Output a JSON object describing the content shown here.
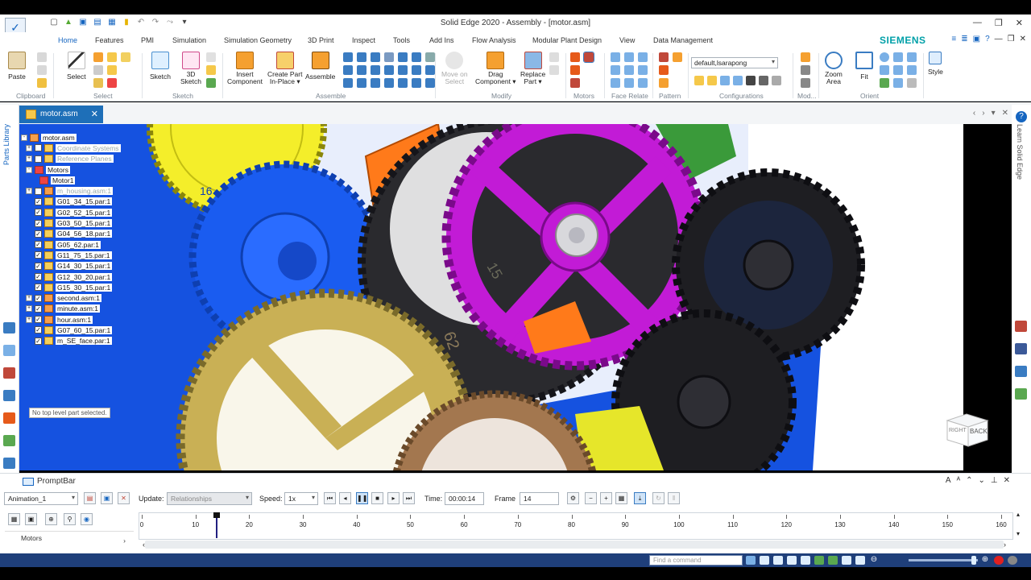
{
  "window": {
    "title": "Solid Edge 2020 - Assembly - [motor.asm]",
    "brand": "SIEMENS"
  },
  "tabs": [
    "Home",
    "Features",
    "PMI",
    "Simulation",
    "Simulation Geometry",
    "3D Print",
    "Inspect",
    "Tools",
    "Add Ins",
    "Flow Analysis",
    "Modular Plant Design",
    "View",
    "Data Management"
  ],
  "ribbon": {
    "buttons": {
      "paste": "Paste",
      "select": "Select",
      "sketch": "Sketch",
      "sketch3d": "3D\nSketch",
      "insert_component": "Insert\nComponent",
      "create_part": "Create Part\nIn-Place ▾",
      "assemble": "Assemble",
      "move_on_select": "Move on\nSelect",
      "drag_component": "Drag\nComponent ▾",
      "replace_part": "Replace\nPart ▾",
      "zoom_area": "Zoom\nArea",
      "fit": "Fit",
      "style": "Style"
    },
    "groups": {
      "clipboard": "Clipboard",
      "select": "Select",
      "sketch": "Sketch",
      "assemble": "Assemble",
      "modify": "Modify",
      "motors": "Motors",
      "face_relate": "Face Relate",
      "pattern": "Pattern",
      "configurations": "Configurations",
      "modify2": "Mod...",
      "orient": "Orient"
    },
    "configuration_value": "default,lsarapong"
  },
  "document": {
    "tab_label": "motor.asm"
  },
  "side": {
    "left_panel": "Parts Library",
    "right_panel": "Learn Solid Edge"
  },
  "tree": {
    "items": [
      {
        "label": "motor.asm",
        "level": 0,
        "exp": "-",
        "cb": false,
        "icon": "asm"
      },
      {
        "label": "Coordinate Systems",
        "level": 1,
        "exp": "+",
        "cb": "",
        "icon": "coord",
        "dim": true
      },
      {
        "label": "Reference Planes",
        "level": 1,
        "exp": "+",
        "cb": "",
        "icon": "planes",
        "dim": true
      },
      {
        "label": "Motors",
        "level": 1,
        "exp": "-",
        "cb": null,
        "icon": "motor"
      },
      {
        "label": "Motor1",
        "level": 2,
        "exp": null,
        "cb": null,
        "icon": "motor"
      },
      {
        "label": "m_housing.asm:1",
        "level": 1,
        "exp": "+",
        "cb": "",
        "icon": "asm",
        "dim": true
      },
      {
        "label": "G01_34_15.par:1",
        "level": 1,
        "exp": null,
        "cb": "✓",
        "icon": "part"
      },
      {
        "label": "G02_52_15.par:1",
        "level": 1,
        "exp": null,
        "cb": "✓",
        "icon": "part"
      },
      {
        "label": "G03_50_15.par:1",
        "level": 1,
        "exp": null,
        "cb": "✓",
        "icon": "part"
      },
      {
        "label": "G04_56_18.par:1",
        "level": 1,
        "exp": null,
        "cb": "✓",
        "icon": "part"
      },
      {
        "label": "G05_62.par:1",
        "level": 1,
        "exp": null,
        "cb": "✓",
        "icon": "part"
      },
      {
        "label": "G11_75_15.par:1",
        "level": 1,
        "exp": null,
        "cb": "✓",
        "icon": "part"
      },
      {
        "label": "G14_30_15.par:1",
        "level": 1,
        "exp": null,
        "cb": "✓",
        "icon": "part"
      },
      {
        "label": "G12_30_20.par:1",
        "level": 1,
        "exp": null,
        "cb": "✓",
        "icon": "part"
      },
      {
        "label": "G15_30_15.par:1",
        "level": 1,
        "exp": null,
        "cb": "✓",
        "icon": "part"
      },
      {
        "label": "second.asm:1",
        "level": 1,
        "exp": "+",
        "cb": "✓",
        "icon": "asm"
      },
      {
        "label": "minute.asm:1",
        "level": 1,
        "exp": "+",
        "cb": "✓",
        "icon": "asm"
      },
      {
        "label": "hour.asm:1",
        "level": 1,
        "exp": "+",
        "cb": "✓",
        "icon": "asm"
      },
      {
        "label": "G07_60_15.par:1",
        "level": 1,
        "exp": null,
        "cb": "✓",
        "icon": "part"
      },
      {
        "label": "m_SE_face.par:1",
        "level": 1,
        "exp": null,
        "cb": "✓",
        "icon": "part"
      }
    ],
    "status_note": "No top level part selected."
  },
  "viewport": {
    "gear_labels": [
      "15",
      "62",
      "16"
    ],
    "viewcube": {
      "right": "RIGHT",
      "back": "BACK"
    }
  },
  "promptbar": {
    "label": "PromptBar"
  },
  "animation": {
    "name": "Animation_1",
    "update_label": "Update:",
    "update_value": "Relationships",
    "speed_label": "Speed:",
    "speed_value": "1x",
    "time_label": "Time:",
    "time_value": "00:00:14",
    "frame_label": "Frame",
    "frame_value": "14",
    "timeline_ticks": [
      "0",
      "10",
      "20",
      "30",
      "40",
      "50",
      "60",
      "70",
      "80",
      "90",
      "100",
      "110",
      "120",
      "130",
      "140",
      "150",
      "160"
    ],
    "timeline_cursor_frame": 14,
    "tree_item": "Motors"
  },
  "statusbar": {
    "find_placeholder": "Find a command"
  },
  "colors": {
    "accent": "#1565c0",
    "doc_tab": "#1e6fb8",
    "status_bg": "#1f3f7a",
    "brand": "#00a0a8",
    "gear_yellow": "#f4ee2a",
    "gear_blue": "#1255e6",
    "gear_magenta": "#c21bd6",
    "gear_black": "#2a2a2e",
    "gear_gold": "#c9b055",
    "gear_orange": "#ff7a1a",
    "gear_brown": "#a3774f"
  }
}
